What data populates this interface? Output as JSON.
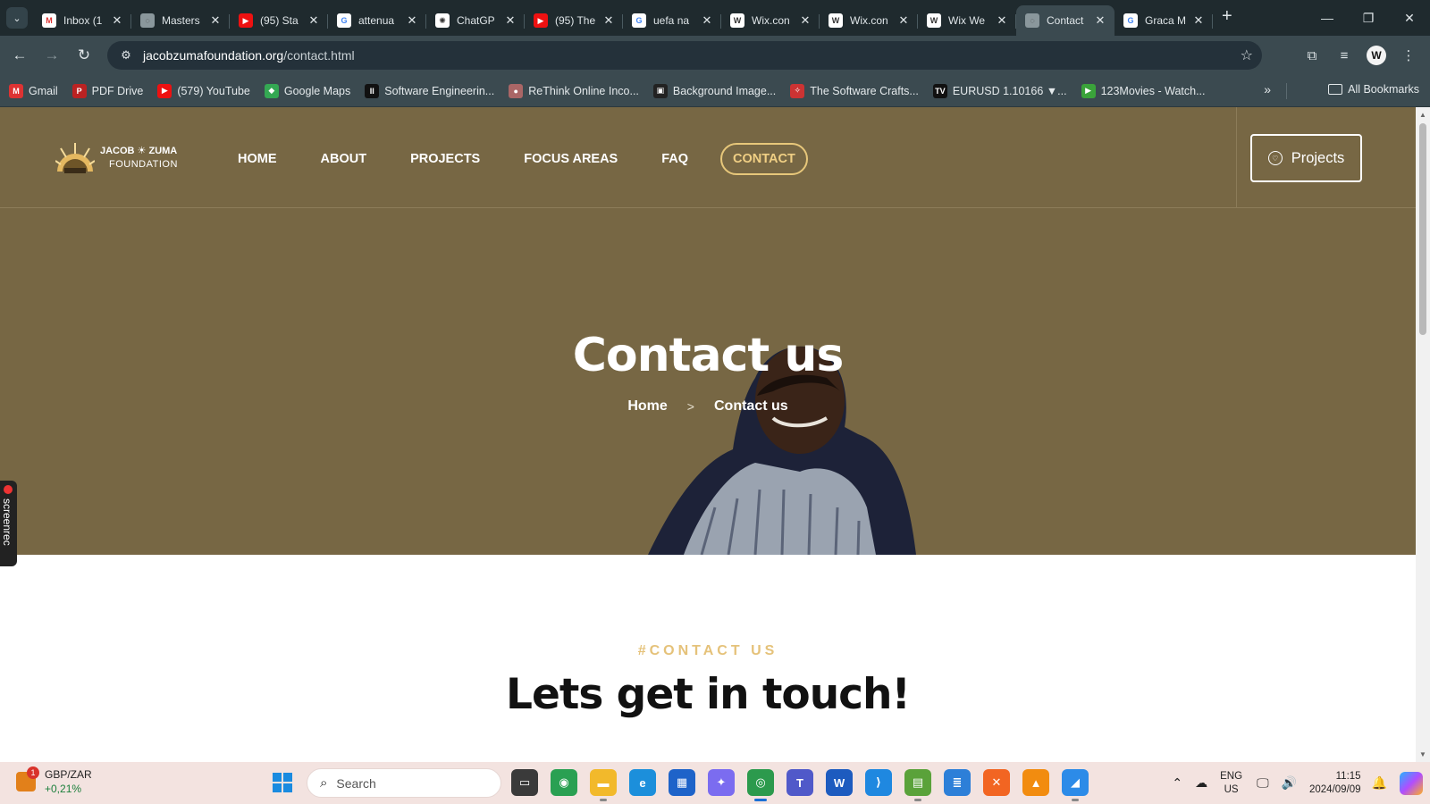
{
  "browser": {
    "tabs": [
      {
        "title": "Inbox (1",
        "favicon": "gmail-icon",
        "active": false
      },
      {
        "title": "Masters",
        "favicon": "globe-icon",
        "active": false
      },
      {
        "title": "(95) Sta",
        "favicon": "youtube-icon",
        "active": false
      },
      {
        "title": "attenua",
        "favicon": "google-icon",
        "active": false
      },
      {
        "title": "ChatGP",
        "favicon": "chatgpt-icon",
        "active": false
      },
      {
        "title": "(95) The",
        "favicon": "youtube-icon",
        "active": false
      },
      {
        "title": "uefa na",
        "favicon": "google-icon",
        "active": false
      },
      {
        "title": "Wix.con",
        "favicon": "wix-icon",
        "active": false
      },
      {
        "title": "Wix.con",
        "favicon": "wix-icon",
        "active": false
      },
      {
        "title": "Wix We",
        "favicon": "wix-icon",
        "active": false
      },
      {
        "title": "Contact",
        "favicon": "globe-icon",
        "active": true
      },
      {
        "title": "Graca M",
        "favicon": "google-icon",
        "active": false
      }
    ],
    "url_host": "jacobzumafoundation.org",
    "url_path": "/contact.html",
    "bookmarks": [
      {
        "label": "Gmail",
        "icon": "gmail-icon"
      },
      {
        "label": "PDF Drive",
        "icon": "pdf-drive-icon"
      },
      {
        "label": "(579) YouTube",
        "icon": "youtube-icon"
      },
      {
        "label": "Google Maps",
        "icon": "maps-icon"
      },
      {
        "label": "Software Engineerin...",
        "icon": "medium-icon"
      },
      {
        "label": "ReThink Online Inco...",
        "icon": "rethink-icon"
      },
      {
        "label": "Background Image...",
        "icon": "image-icon"
      },
      {
        "label": "The Software Crafts...",
        "icon": "crafts-icon"
      },
      {
        "label": "EURUSD 1.10166 ▼...",
        "icon": "tradingview-icon"
      },
      {
        "label": "123Movies - Watch...",
        "icon": "play-icon"
      }
    ],
    "all_bookmarks": "All Bookmarks"
  },
  "site": {
    "logo_line1": "JACOB ☀ ZUMA",
    "logo_line2": "FOUNDATION",
    "nav": [
      {
        "label": "HOME",
        "active": false
      },
      {
        "label": "ABOUT",
        "active": false
      },
      {
        "label": "PROJECTS",
        "active": false
      },
      {
        "label": "FOCUS AREAS",
        "active": false
      },
      {
        "label": "FAQ",
        "active": false
      },
      {
        "label": "CONTACT",
        "active": true
      }
    ],
    "projects_button": "Projects",
    "hero_title": "Contact us",
    "breadcrumb_home": "Home",
    "breadcrumb_sep": ">",
    "breadcrumb_current": "Contact us",
    "eyebrow": "#CONTACT US",
    "headline": "Lets get in touch!",
    "colors": {
      "hero_bg": "#776744",
      "accent": "#e5c27a"
    }
  },
  "overlay": {
    "screenrec_label": "screenrec"
  },
  "taskbar": {
    "ticker": "GBP/ZAR",
    "ticker_change": "+0,21%",
    "ticker_badge": "1",
    "search_placeholder": "Search",
    "lang_line1": "ENG",
    "lang_line2": "US",
    "time": "11:15",
    "date": "2024/09/09"
  }
}
